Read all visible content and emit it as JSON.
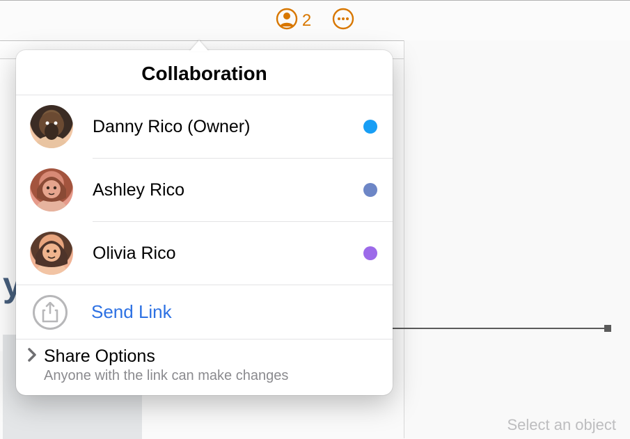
{
  "toolbar": {
    "collab_count": "2"
  },
  "popover": {
    "title": "Collaboration",
    "participants": [
      {
        "name": "Danny Rico (Owner)",
        "dot_color": "#189ef5",
        "avatar_bg": "#f2c7a5"
      },
      {
        "name": "Ashley Rico",
        "dot_color": "#6d86c6",
        "avatar_bg": "#e69a8a"
      },
      {
        "name": "Olivia Rico",
        "dot_color": "#9c6ae9",
        "avatar_bg": "#f0b294"
      }
    ],
    "send_link": "Send Link",
    "share": {
      "label": "Share Options",
      "subtitle": "Anyone with the link can make changes"
    }
  },
  "sidebar": {
    "hint": "Select an object"
  }
}
